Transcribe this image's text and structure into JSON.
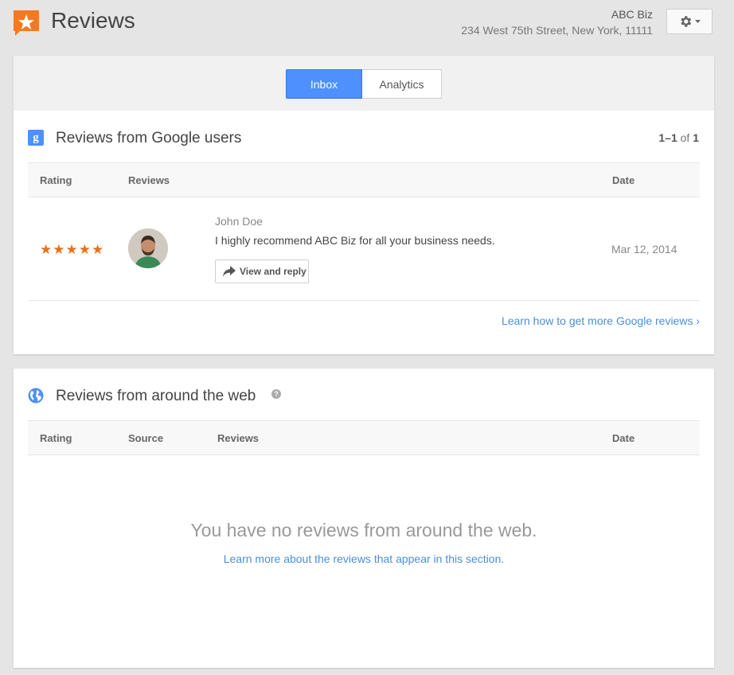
{
  "header": {
    "title": "Reviews",
    "business_name": "ABC Biz",
    "business_address": "234 West 75th Street, New York, 11111"
  },
  "tabs": [
    {
      "label": "Inbox",
      "active": true
    },
    {
      "label": "Analytics",
      "active": false
    }
  ],
  "google_section": {
    "title": "Reviews from Google users",
    "pager_start": "1",
    "pager_end": "1",
    "pager_of": "of",
    "pager_total": "1",
    "columns": {
      "rating": "Rating",
      "reviews": "Reviews",
      "date": "Date"
    },
    "reviews": [
      {
        "stars": "★★★★★",
        "rating_value": 5,
        "author": "John Doe",
        "text": "I highly recommend ABC Biz for all your business needs.",
        "reply_label": "View and reply",
        "date": "Mar 12, 2014"
      }
    ],
    "learn_link": "Learn how to get more Google reviews ›"
  },
  "web_section": {
    "title": "Reviews from around the web",
    "columns": {
      "rating": "Rating",
      "source": "Source",
      "reviews": "Reviews",
      "date": "Date"
    },
    "empty_message": "You have no reviews from around the web.",
    "empty_link": "Learn more about the reviews that appear in this section."
  },
  "colors": {
    "accent": "#4d90fe",
    "star": "#e8701a",
    "logo": "#f47920",
    "link": "#4a8fd8"
  },
  "icons": [
    "reviews-logo-icon",
    "gear-icon",
    "chevron-down-icon",
    "google-plus-icon",
    "reply-arrow-icon",
    "globe-icon",
    "help-icon"
  ]
}
